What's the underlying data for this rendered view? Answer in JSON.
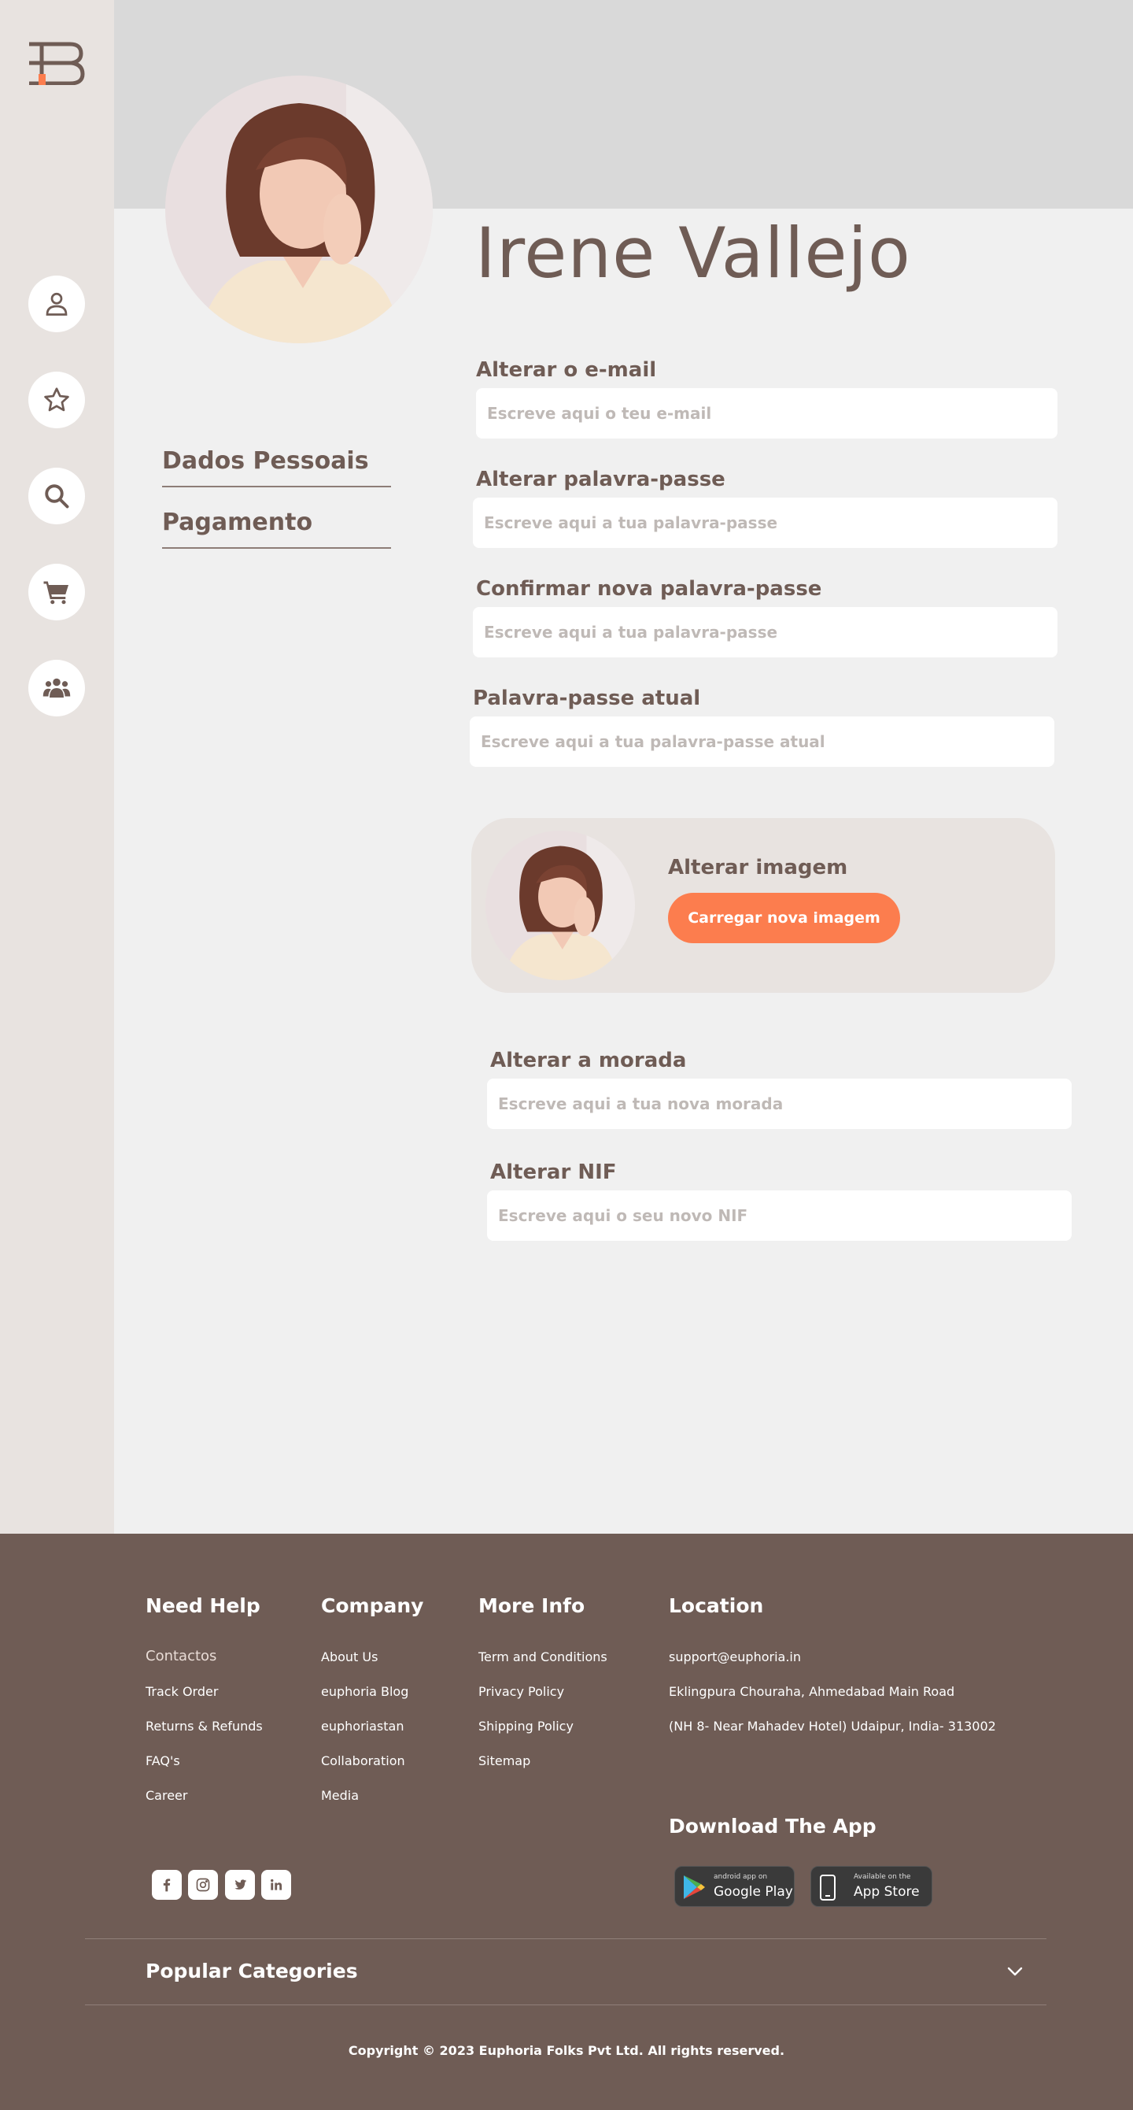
{
  "profile": {
    "name": "Irene Vallejo"
  },
  "side_nav": [
    {
      "label": "Dados Pessoais"
    },
    {
      "label": "Pagamento"
    }
  ],
  "form": {
    "email": {
      "label": "Alterar o e-mail",
      "placeholder": "Escreve aqui o teu e-mail"
    },
    "password": {
      "label": "Alterar palavra-passe",
      "placeholder": "Escreve aqui a tua palavra-passe"
    },
    "confirm_password": {
      "label": "Confirmar nova palavra-passe",
      "placeholder": "Escreve aqui a tua palavra-passe"
    },
    "current_password": {
      "label": "Palavra-passe atual",
      "placeholder": "Escreve aqui a tua palavra-passe atual"
    },
    "address": {
      "label": "Alterar a morada",
      "placeholder": "Escreve aqui a tua nova morada"
    },
    "nif": {
      "label": "Alterar NIF",
      "placeholder": "Escreve aqui o seu novo NIF"
    }
  },
  "image_card": {
    "label": "Alterar imagem",
    "button": "Carregar nova imagem"
  },
  "sidebar_icons": [
    "user-icon",
    "star-icon",
    "search-icon",
    "cart-icon",
    "group-icon"
  ],
  "footer": {
    "need_help": {
      "title": "Need Help",
      "links": [
        "Contactos",
        "Track Order",
        "Returns & Refunds",
        "FAQ's",
        "Career"
      ]
    },
    "company": {
      "title": "Company",
      "links": [
        "About Us",
        "euphoria Blog",
        "euphoriastan",
        "Collaboration",
        "Media"
      ]
    },
    "more_info": {
      "title": "More Info",
      "links": [
        "Term and Conditions",
        "Privacy Policy",
        "Shipping Policy",
        "Sitemap"
      ]
    },
    "location": {
      "title": "Location",
      "lines": [
        "support@euphoria.in",
        "Eklingpura Chouraha, Ahmedabad Main Road",
        "(NH 8- Near Mahadev Hotel) Udaipur, India- 313002"
      ]
    },
    "download": {
      "title": "Download The App"
    },
    "google_play": {
      "small": "android app on",
      "big": "Google Play"
    },
    "app_store": {
      "small": "Available on the",
      "big": "App Store"
    },
    "social": [
      "facebook-icon",
      "instagram-icon",
      "twitter-icon",
      "linkedin-icon"
    ],
    "popular_categories": "Popular Categories",
    "copyright": "Copyright © 2023 Euphoria Folks Pvt Ltd. All rights reserved."
  },
  "colors": {
    "brand_brown": "#6f5c55",
    "accent_orange": "#fc7d4e",
    "sidebar_bg": "#e8e3e0",
    "banner_bg": "#d9d9d9"
  }
}
